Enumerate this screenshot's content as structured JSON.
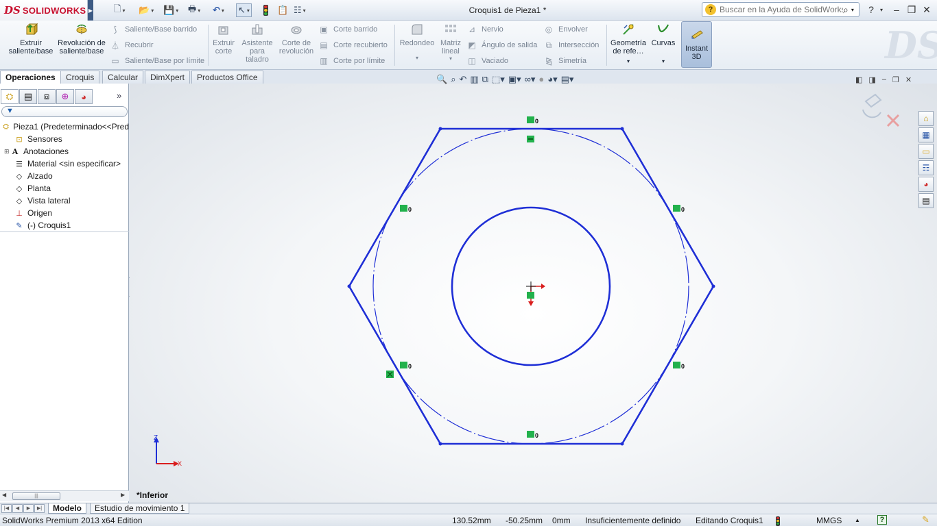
{
  "app": {
    "logo_mark": "DS",
    "logo_text": "SOLIDWORKS",
    "window_title": "Croquis1 de Pieza1 *"
  },
  "help_search": {
    "placeholder": "Buscar en la Ayuda de SolidWorks"
  },
  "ribbon": {
    "extrude_boss": "Extruir saliente/base",
    "revolve_boss": "Revolución de saliente/base",
    "swept_boss": "Saliente/Base barrido",
    "loft_boss": "Recubrir",
    "boundary_boss": "Saliente/Base por límite",
    "extrude_cut": "Extruir corte",
    "hole_wizard": "Asistente para taladro",
    "revolve_cut": "Corte de revolución",
    "swept_cut": "Corte barrido",
    "loft_cut": "Corte recubierto",
    "boundary_cut": "Corte por límite",
    "fillet": "Redondeo",
    "linear_pattern": "Matriz lineal",
    "rib": "Nervio",
    "draft": "Ángulo de salida",
    "shell": "Vaciado",
    "wrap": "Envolver",
    "intersect": "Intersección",
    "mirror": "Simetría",
    "ref_geometry": "Geometría de refe…",
    "curves": "Curvas",
    "instant3d": "Instant 3D"
  },
  "tabs": [
    "Operaciones",
    "Croquis",
    "Calcular",
    "DimXpert",
    "Productos Office"
  ],
  "tree": {
    "root": "Pieza1  (Predeterminado<<Pred",
    "items": [
      "Sensores",
      "Anotaciones",
      "Material <sin especificar>",
      "Alzado",
      "Planta",
      "Vista lateral",
      "Origen",
      "(-) Croquis1"
    ]
  },
  "graphics": {
    "view_label": "*Inferior",
    "triad_z": "Z",
    "triad_x": "X",
    "relation_mark": "0"
  },
  "bottom_tabs": [
    "Modelo",
    "Estudio de movimiento 1"
  ],
  "status": {
    "edition": "SolidWorks Premium 2013 x64 Edition",
    "x": "130.52mm",
    "y": "-50.25mm",
    "z": "0mm",
    "definition": "Insuficientemente definido",
    "editing": "Editando Croquis1",
    "units": "MMGS",
    "help": "?"
  },
  "colors": {
    "sketch": "#1f2fd6",
    "relation": "#22b14c",
    "brand": "#c8102e"
  }
}
